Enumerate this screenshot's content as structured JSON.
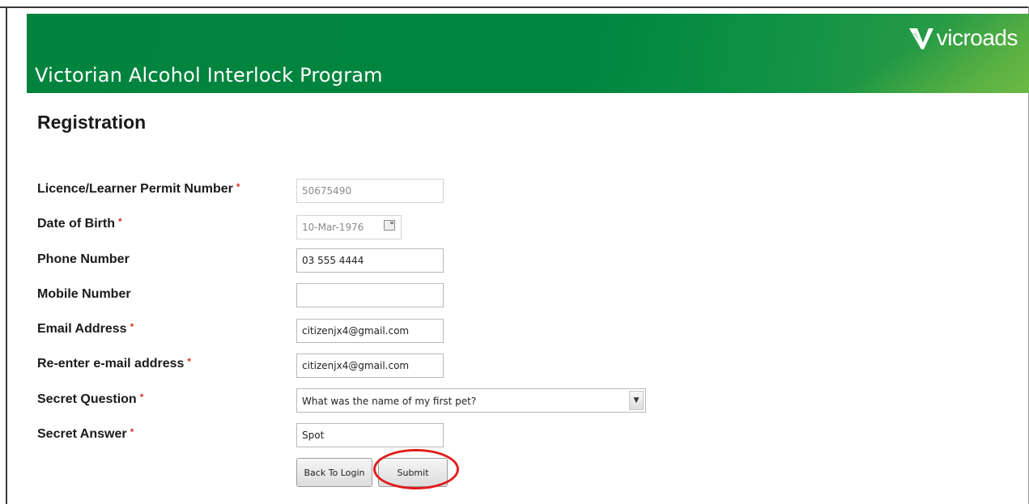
{
  "header": {
    "program_title": "Victorian Alcohol Interlock Program",
    "logo_text": "vicroads",
    "brand_color": "#00843d"
  },
  "page": {
    "title": "Registration"
  },
  "form": {
    "required_marker": "*",
    "licence": {
      "label": "Licence/Learner Permit Number",
      "value": "50675490",
      "required": true,
      "disabled": true
    },
    "dob": {
      "label": "Date of Birth",
      "value": "10-Mar-1976",
      "required": true,
      "disabled": true,
      "icon": "calendar-icon"
    },
    "phone": {
      "label": "Phone Number",
      "value": "03 555 4444"
    },
    "mobile": {
      "label": "Mobile Number",
      "value": ""
    },
    "email": {
      "label": "Email Address",
      "value": "citizenjx4@gmail.com",
      "required": true
    },
    "email_confirm": {
      "label": "Re-enter e-mail address",
      "value": "citizenjx4@gmail.com",
      "required": true
    },
    "secret_question": {
      "label": "Secret Question",
      "value": "What was the name of my first pet?",
      "required": true
    },
    "secret_answer": {
      "label": "Secret Answer",
      "value": "Spot",
      "required": true
    }
  },
  "buttons": {
    "back_label": "Back To Login",
    "submit_label": "Submit"
  },
  "annotation": {
    "color": "#e11c1c",
    "target": "submit-button"
  }
}
